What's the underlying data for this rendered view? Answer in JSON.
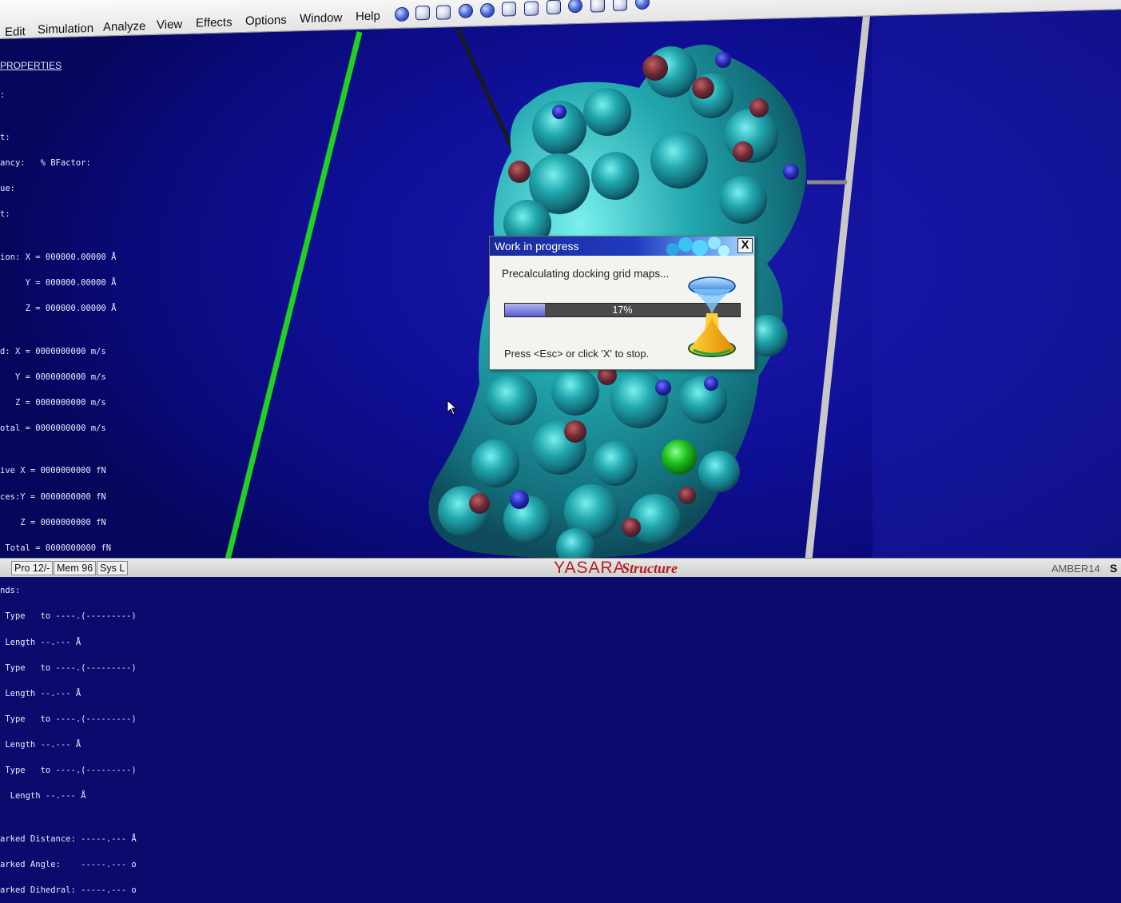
{
  "app": {
    "name": "YASARA",
    "name_suffix": "Structure"
  },
  "menubar": {
    "items": [
      {
        "label": "Edit"
      },
      {
        "label": "Simulation"
      },
      {
        "label": "Analyze"
      },
      {
        "label": "View"
      },
      {
        "label": "Effects"
      },
      {
        "label": "Options"
      },
      {
        "label": "Window"
      },
      {
        "label": "Help"
      }
    ],
    "toolbar_icons": [
      "rotate-icon",
      "zoom-out-icon",
      "zoom-in-icon",
      "center-icon",
      "globe-icon",
      "copy-icon",
      "paste-icon",
      "print-icon",
      "move-icon",
      "rewind-icon",
      "forward-icon",
      "info-icon"
    ]
  },
  "properties": {
    "heading": "PROPERTIES",
    "lines": [
      ":",
      "",
      "t:",
      "ancy:   % BFactor:",
      "ue:",
      "t:",
      "",
      "ion: X = 000000.00000 Å",
      "     Y = 000000.00000 Å",
      "     Z = 000000.00000 Å",
      "",
      "d: X = 0000000000 m/s",
      "   Y = 0000000000 m/s",
      "   Z = 0000000000 m/s",
      "otal = 0000000000 m/s",
      "",
      "ive X = 0000000000 fN",
      "ces:Y = 0000000000 fN",
      "    Z = 0000000000 fN",
      " Total = 0000000000 fN",
      "",
      "nds:",
      " Type   to ----.(---------)",
      " Length --.--- Å",
      " Type   to ----.(---------)",
      " Length --.--- Å",
      " Type   to ----.(---------)",
      " Length --.--- Å",
      " Type   to ----.(---------)",
      "  Length --.--- Å",
      "",
      "arked Distance: -----.--- Å",
      "arked Angle:    -----.--- o",
      "arked Dihedral: -----.--- o"
    ]
  },
  "dialog": {
    "title": "Work in progress",
    "close_label": "X",
    "message": "Precalculating docking grid maps...",
    "progress": 0.17,
    "progress_label": "17%",
    "hint": "Press <Esc> or click 'X' to stop."
  },
  "statusbar": {
    "cells": [
      "Pro 12/-",
      "Mem 96",
      "Sys L"
    ],
    "forcefield": "AMBER14",
    "trailing": "S"
  },
  "colors": {
    "background": "#0b0b6e",
    "surface": "#1fa0a0",
    "axis_green": "#2bd02b",
    "brand_red": "#b51e1e"
  }
}
